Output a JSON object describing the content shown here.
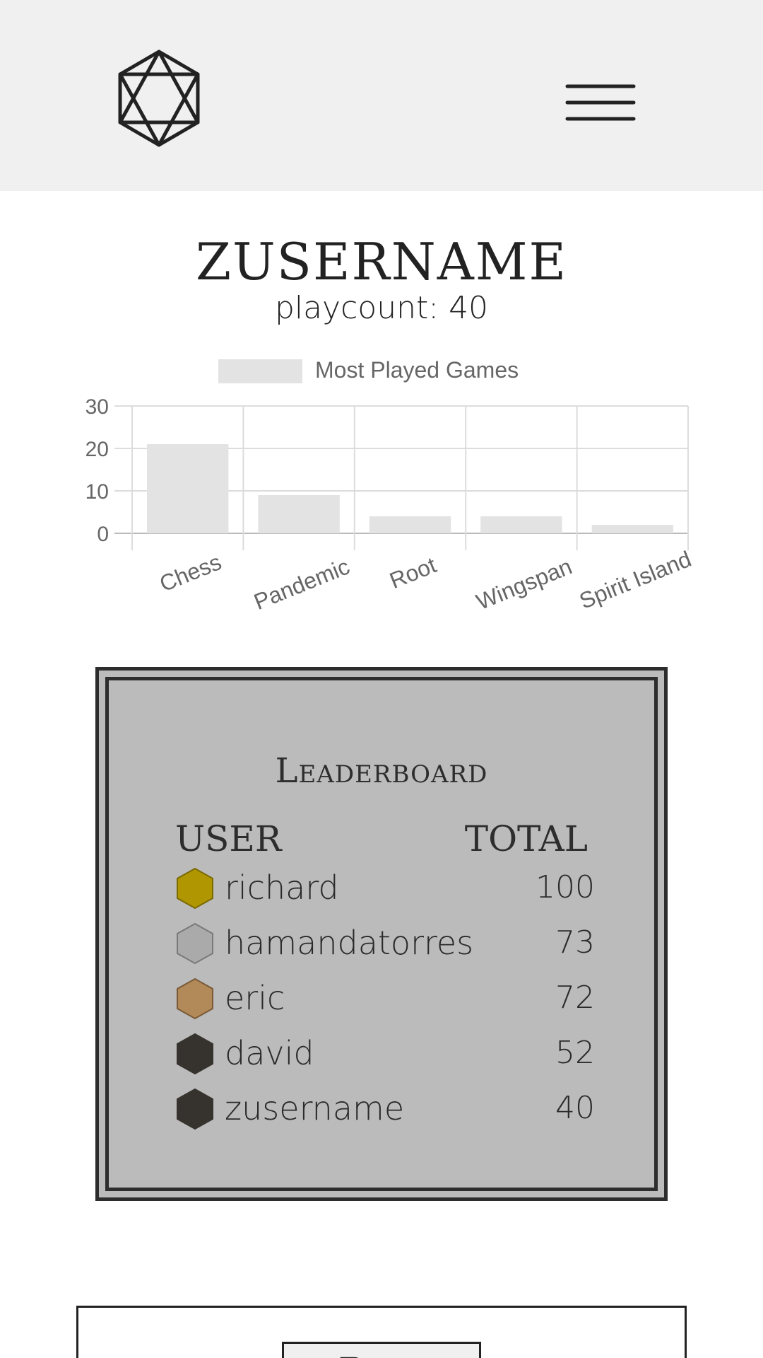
{
  "header": {
    "logo_icon": "d20-icon",
    "menu_icon": "hamburger-menu-icon",
    "background": "#f0f0f0"
  },
  "profile": {
    "username": "ZUSERNAME",
    "playcount_label": "playcount:",
    "playcount_value": "40"
  },
  "chart_data": {
    "type": "bar",
    "title": "",
    "legend": [
      "Most Played Games"
    ],
    "legend_position": "top",
    "categories": [
      "Chess",
      "Pandemic",
      "Root",
      "Wingspan",
      "Spirit Island"
    ],
    "series": [
      {
        "name": "Most Played Games",
        "values": [
          21,
          9,
          4,
          4,
          2
        ]
      }
    ],
    "ylim": [
      0,
      30
    ],
    "yticks": [
      0,
      10,
      20,
      30
    ],
    "grid": true,
    "bar_color": "#e3e3e3"
  },
  "leaderboard": {
    "title": "Leaderboard",
    "col_user": "USER",
    "col_total": "TOTAL",
    "rows": [
      {
        "user": "richard",
        "total": "100",
        "badge_color": "#b09600",
        "badge_stroke": "#7a6a00"
      },
      {
        "user": "hamandatorres",
        "total": "73",
        "badge_color": "#aaaaaa",
        "badge_stroke": "#7a7a7a"
      },
      {
        "user": "eric",
        "total": "72",
        "badge_color": "#b28a5a",
        "badge_stroke": "#7a5a36"
      },
      {
        "user": "david",
        "total": "52",
        "badge_color": "#36322d",
        "badge_stroke": "#36322d"
      },
      {
        "user": "zusername",
        "total": "40",
        "badge_color": "#36322d",
        "badge_stroke": "#36322d"
      }
    ]
  },
  "game_card": {
    "tag_label": "Root"
  }
}
